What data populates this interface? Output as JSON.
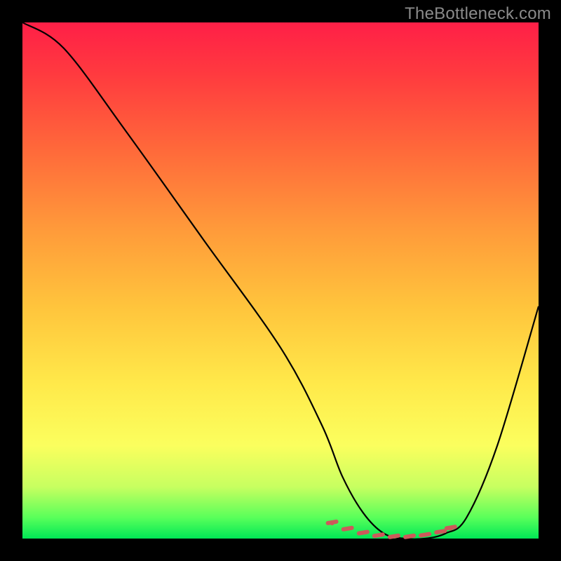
{
  "watermark": "TheBottleneck.com",
  "colors": {
    "gradient_top": "#ff1f47",
    "gradient_bottom": "#00e756",
    "curve_stroke": "#000000",
    "marker_stroke": "#cc5a5a",
    "background": "#000000"
  },
  "chart_data": {
    "type": "line",
    "title": "",
    "xlabel": "",
    "ylabel": "",
    "xlim": [
      0,
      100
    ],
    "ylim": [
      0,
      100
    ],
    "series": [
      {
        "name": "bottleneck-curve",
        "x": [
          0,
          8,
          20,
          35,
          50,
          58,
          62,
          66,
          70,
          74,
          78,
          82,
          86,
          92,
          100
        ],
        "y": [
          100,
          95,
          79,
          58,
          37,
          22,
          12,
          5,
          1,
          0,
          0,
          1,
          4,
          18,
          45
        ]
      },
      {
        "name": "highlight-markers",
        "x": [
          60,
          63,
          66,
          69,
          72,
          75,
          78,
          81,
          83
        ],
        "y": [
          3.0,
          1.8,
          1.0,
          0.5,
          0.3,
          0.3,
          0.6,
          1.2,
          2.0
        ]
      }
    ]
  }
}
